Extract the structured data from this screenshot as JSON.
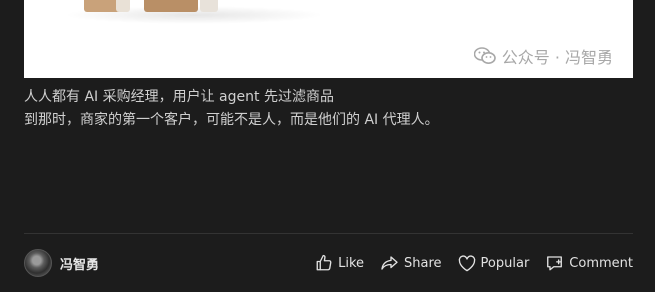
{
  "image": {
    "watermark_text": "公众号 · 冯智勇",
    "watermark_icon": "wechat-icon"
  },
  "caption": {
    "line1": "人人都有 AI 采购经理，用户让 agent 先过滤商品",
    "line2": "到那时，商家的第一个客户，可能不是人，而是他们的 AI 代理人。"
  },
  "author": {
    "name": "冯智勇",
    "avatar_icon": "avatar"
  },
  "actions": {
    "like": "Like",
    "share": "Share",
    "popular": "Popular",
    "comment": "Comment"
  }
}
